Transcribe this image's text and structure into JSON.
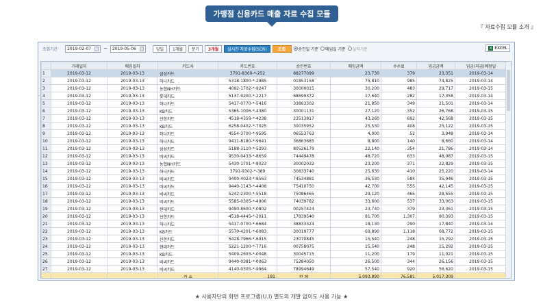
{
  "banner_title": "가맹점 신용카드 매출 자료 수집 모듈",
  "subtitle": "『 자료수집 모듈 소개 』",
  "toolbar": {
    "period_label": "조회기간",
    "date_from": "2019-02-07",
    "tilde": "~",
    "date_to": "2019-05-06",
    "btn_day": "당일",
    "btn_1m": "1개월",
    "btn_half": "분기",
    "btn_3m": "3개월",
    "btn_realtime": "실시간 자료수집(SCR)",
    "btn_search": "조회",
    "radio_approve": "승인일 기준",
    "radio_sales": "매입일 기준",
    "radio_paid": "실적기준",
    "excel": "EXCEL",
    "excel_icon": "X"
  },
  "columns": [
    "거래일자",
    "매입일자",
    "카드사",
    "카드번호",
    "승인번호",
    "매입금액",
    "수수료",
    "입금금액",
    "입금(지급)예정일"
  ],
  "rows": [
    {
      "n": "1",
      "d": "2019-03-12",
      "b": "2019-03-13",
      "card": "삼성카드",
      "no": "3791-8360-*-252",
      "ap": "88277099",
      "amt": "23,730",
      "fee": "379",
      "dep": "23,351",
      "pd": "2019-03-14"
    },
    {
      "n": "2",
      "d": "2019-03-12",
      "b": "2019-03-13",
      "card": "하나카드",
      "no": "5318-1800-*-2985",
      "ap": "01853158",
      "amt": "75,810",
      "fee": "985",
      "dep": "74,825",
      "pd": "2019-03-14"
    },
    {
      "n": "3",
      "d": "2019-03-12",
      "b": "2019-03-13",
      "card": "농협NH카드",
      "no": "4092-1702-*-9247",
      "ap": "30000015",
      "amt": "30,200",
      "fee": "483",
      "dep": "29,717",
      "pd": "2019-03-15"
    },
    {
      "n": "4",
      "d": "2019-03-12",
      "b": "2019-03-13",
      "card": "롯데카드",
      "no": "5137-9200-*-2217",
      "ap": "68699372",
      "amt": "17,640",
      "fee": "282",
      "dep": "17,358",
      "pd": "2019-03-14"
    },
    {
      "n": "5",
      "d": "2019-03-12",
      "b": "2019-03-13",
      "card": "하나카드",
      "no": "5417-0770-*-5416",
      "ap": "33863302",
      "amt": "21,850",
      "fee": "349",
      "dep": "21,501",
      "pd": "2019-03-14"
    },
    {
      "n": "6",
      "d": "2019-03-12",
      "b": "2019-03-13",
      "card": "KB카드",
      "no": "5365-1006-*-4380",
      "ap": "30001131",
      "amt": "27,120",
      "fee": "352",
      "dep": "26,768",
      "pd": "2019-03-15"
    },
    {
      "n": "7",
      "d": "2019-03-12",
      "b": "2019-03-13",
      "card": "신한카드",
      "no": "4518-4359-*-4238",
      "ap": "23513817",
      "amt": "43,260",
      "fee": "692",
      "dep": "42,568",
      "pd": "2019-03-15"
    },
    {
      "n": "8",
      "d": "2019-03-12",
      "b": "2019-03-13",
      "card": "KB카드",
      "no": "6258-0402-*-7025",
      "ap": "30035952",
      "amt": "25,530",
      "fee": "408",
      "dep": "25,122",
      "pd": "2019-03-15"
    },
    {
      "n": "9",
      "d": "2019-03-12",
      "b": "2019-03-13",
      "card": "하나카드",
      "no": "4554-3700-*-9595",
      "ap": "06553763",
      "amt": "4,000",
      "fee": "52",
      "dep": "3,948",
      "pd": "2019-03-14"
    },
    {
      "n": "10",
      "d": "2019-03-12",
      "b": "2019-03-13",
      "card": "하나카드",
      "no": "9411-8180-*-9641",
      "ap": "36863685",
      "amt": "8,800",
      "fee": "140",
      "dep": "8,660",
      "pd": "2019-03-14"
    },
    {
      "n": "11",
      "d": "2019-03-12",
      "b": "2019-03-13",
      "card": "삼성카드",
      "no": "5188-3110-*-5293",
      "ap": "80526179",
      "amt": "22,140",
      "fee": "354",
      "dep": "21,786",
      "pd": "2019-03-14"
    },
    {
      "n": "12",
      "d": "2019-03-12",
      "b": "2019-03-13",
      "card": "비씨카드",
      "no": "9530-0433-*-8659",
      "ap": "74449478",
      "amt": "48,720",
      "fee": "633",
      "dep": "48,087",
      "pd": "2019-03-15"
    },
    {
      "n": "13",
      "d": "2019-03-12",
      "b": "2019-03-13",
      "card": "농협NH카드",
      "no": "5430-1701-*-8023",
      "ap": "30002032",
      "amt": "23,200",
      "fee": "371",
      "dep": "22,829",
      "pd": "2019-03-15"
    },
    {
      "n": "14",
      "d": "2019-03-12",
      "b": "2019-03-13",
      "card": "하나카드",
      "no": "3791-9302-*-389",
      "ap": "30833740",
      "amt": "25,630",
      "fee": "410",
      "dep": "25,220",
      "pd": "2019-03-14"
    },
    {
      "n": "15",
      "d": "2019-03-12",
      "b": "2019-03-13",
      "card": "비씨카드",
      "no": "9400-4023-*-8563",
      "ap": "74534881",
      "amt": "36,530",
      "fee": "584",
      "dep": "35,946",
      "pd": "2019-03-15"
    },
    {
      "n": "16",
      "d": "2019-03-12",
      "b": "2019-03-13",
      "card": "비씨카드",
      "no": "9440-1143-*-4408",
      "ap": "75410750",
      "amt": "42,700",
      "fee": "555",
      "dep": "42,145",
      "pd": "2019-03-15"
    },
    {
      "n": "17",
      "d": "2019-03-12",
      "b": "2019-03-13",
      "card": "비씨카드",
      "no": "5242-2300-*-5518",
      "ap": "75086465",
      "amt": "29,120",
      "fee": "465",
      "dep": "28,655",
      "pd": "2019-03-15"
    },
    {
      "n": "18",
      "d": "2019-03-12",
      "b": "2019-03-13",
      "card": "비씨카드",
      "no": "5585-0305-*-4906",
      "ap": "74039782",
      "amt": "33,600",
      "fee": "537",
      "dep": "33,063",
      "pd": "2019-03-15"
    },
    {
      "n": "19",
      "d": "2019-03-12",
      "b": "2019-03-13",
      "card": "현대카드",
      "no": "9490-8600-*-0802",
      "ap": "00257424",
      "amt": "23,740",
      "fee": "379",
      "dep": "23,361",
      "pd": "2019-03-15"
    },
    {
      "n": "20",
      "d": "2019-03-12",
      "b": "2019-03-13",
      "card": "신한카드",
      "no": "4518-4445-*-2011",
      "ap": "17839540",
      "amt": "81,700",
      "fee": "1,307",
      "dep": "80,393",
      "pd": "2019-03-15"
    },
    {
      "n": "21",
      "d": "2019-03-12",
      "b": "2019-03-13",
      "card": "하나카드",
      "no": "5417-0700-*-6684",
      "ap": "38833324",
      "amt": "18,130",
      "fee": "290",
      "dep": "17,840",
      "pd": "2019-03-14"
    },
    {
      "n": "22",
      "d": "2019-03-12",
      "b": "2019-03-13",
      "card": "KB카드",
      "no": "5570-4201-*-6083",
      "ap": "30019777",
      "amt": "69,890",
      "fee": "1,118",
      "dep": "68,772",
      "pd": "2019-03-15"
    },
    {
      "n": "23",
      "d": "2019-03-12",
      "b": "2019-03-13",
      "card": "신한카드",
      "no": "5428-7966-*-6915",
      "ap": "23070845",
      "amt": "15,540",
      "fee": "248",
      "dep": "15,292",
      "pd": "2019-03-15"
    },
    {
      "n": "24",
      "d": "2019-03-12",
      "b": "2019-03-13",
      "card": "현대카드",
      "no": "5221-1200-*-7716",
      "ap": "00758075",
      "amt": "15,540",
      "fee": "248",
      "dep": "15,292",
      "pd": "2019-03-15"
    },
    {
      "n": "25",
      "d": "2019-03-12",
      "b": "2019-03-13",
      "card": "KB카드",
      "no": "5409-2603-*-0048",
      "ap": "30045715",
      "amt": "11,200",
      "fee": "179",
      "dep": "11,021",
      "pd": "2019-03-15"
    },
    {
      "n": "26",
      "d": "2019-03-12",
      "b": "2019-03-13",
      "card": "비씨카드",
      "no": "9440-0381-*-0063",
      "ap": "75284050",
      "amt": "26,500",
      "fee": "344",
      "dep": "26,156",
      "pd": "2019-03-15"
    },
    {
      "n": "27",
      "d": "2019-03-12",
      "b": "2019-03-13",
      "card": "비씨카드",
      "no": "4140-0305-*-9964",
      "ap": "78994649",
      "amt": "57,540",
      "fee": "920",
      "dep": "56,620",
      "pd": "2019-03-15"
    }
  ],
  "totals": {
    "count_label": "건 수",
    "count": "181",
    "sum_label": "합 계",
    "amt": "5,093,890",
    "fee": "76,581",
    "dep": "5,017,309"
  },
  "footer_note": "★ 사용자단의 화면 프로그램(U.I) 별도의 개발 없이도 사용 가능 ★"
}
